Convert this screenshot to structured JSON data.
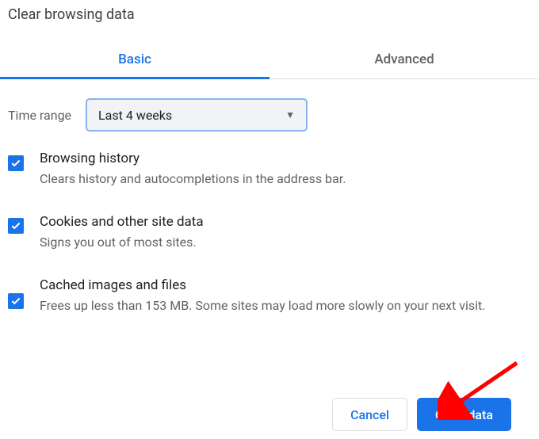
{
  "dialog": {
    "title": "Clear browsing data"
  },
  "tabs": {
    "basic": "Basic",
    "advanced": "Advanced"
  },
  "timeRange": {
    "label": "Time range",
    "selected": "Last 4 weeks"
  },
  "options": [
    {
      "title": "Browsing history",
      "desc": "Clears history and autocompletions in the address bar.",
      "checked": true
    },
    {
      "title": "Cookies and other site data",
      "desc": "Signs you out of most sites.",
      "checked": true
    },
    {
      "title": "Cached images and files",
      "desc": "Frees up less than 153 MB. Some sites may load more slowly on your next visit.",
      "checked": true
    }
  ],
  "actions": {
    "cancel": "Cancel",
    "clear": "Clear data"
  }
}
